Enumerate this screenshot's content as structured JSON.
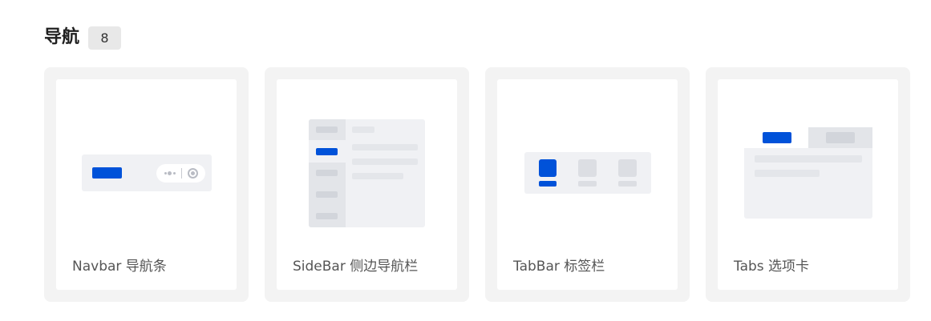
{
  "section": {
    "title": "导航",
    "count": "8"
  },
  "components": [
    {
      "label": "Navbar 导航条",
      "icon": "navbar-preview"
    },
    {
      "label": "SideBar 侧边导航栏",
      "icon": "sidebar-preview"
    },
    {
      "label": "TabBar 标签栏",
      "icon": "tabbar-preview"
    },
    {
      "label": "Tabs 选项卡",
      "icon": "tabs-preview"
    }
  ],
  "colors": {
    "accent": "#0052d9",
    "card_bg": "#f3f3f3",
    "preview_bg": "#f0f1f4",
    "placeholder": "#dcdee3"
  }
}
